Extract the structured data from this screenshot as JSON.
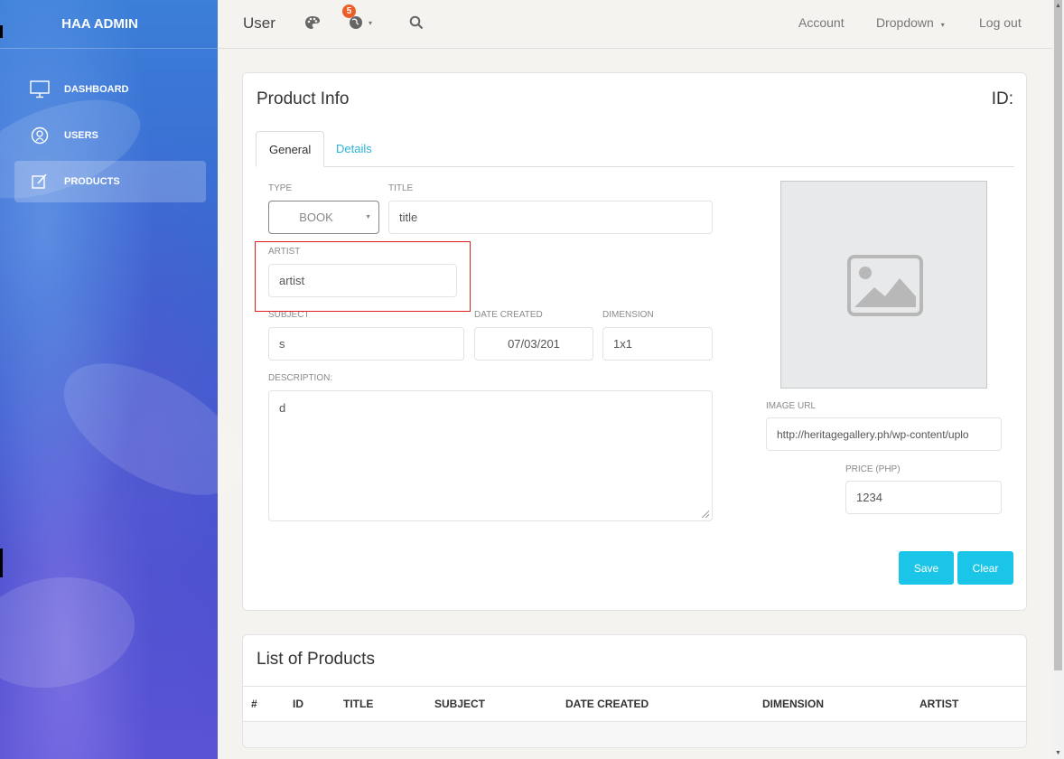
{
  "sidebar": {
    "logo": "HAA ADMIN",
    "items": [
      {
        "label": "DASHBOARD",
        "icon": "monitor-icon",
        "active": false
      },
      {
        "label": "USERS",
        "icon": "user-circle-icon",
        "active": false
      },
      {
        "label": "PRODUCTS",
        "icon": "edit-icon",
        "active": true
      }
    ]
  },
  "topbar": {
    "title": "User",
    "notification_count": "5",
    "links": {
      "account": "Account",
      "dropdown": "Dropdown",
      "logout": "Log out"
    }
  },
  "product_info": {
    "title": "Product Info",
    "id_label": "ID:",
    "tabs": [
      "General",
      "Details"
    ],
    "fields": {
      "type": {
        "label": "TYPE",
        "value": "BOOK"
      },
      "title": {
        "label": "TITLE",
        "value": "title"
      },
      "artist": {
        "label": "ARTIST",
        "value": "artist"
      },
      "subject": {
        "label": "SUBJECT",
        "value": "s"
      },
      "date_created": {
        "label": "DATE CREATED",
        "value": "07/03/201"
      },
      "dimension": {
        "label": "DIMENSION",
        "value": "1x1"
      },
      "description": {
        "label": "DESCRIPTION:",
        "value": "d"
      },
      "image_url": {
        "label": "IMAGE URL",
        "value": "http://heritagegallery.ph/wp-content/uplo"
      },
      "price": {
        "label": "PRICE (PHP)",
        "value": "1234"
      }
    },
    "buttons": {
      "save": "Save",
      "clear": "Clear"
    }
  },
  "product_list": {
    "title": "List of Products",
    "columns": [
      "#",
      "ID",
      "TITLE",
      "SUBJECT",
      "DATE CREATED",
      "DIMENSION",
      "ARTIST"
    ],
    "rows": []
  },
  "colors": {
    "accent": "#1bc5e8",
    "badge": "#eb5e28",
    "highlight": "#e02020",
    "tab_link": "#2fb3d5"
  }
}
